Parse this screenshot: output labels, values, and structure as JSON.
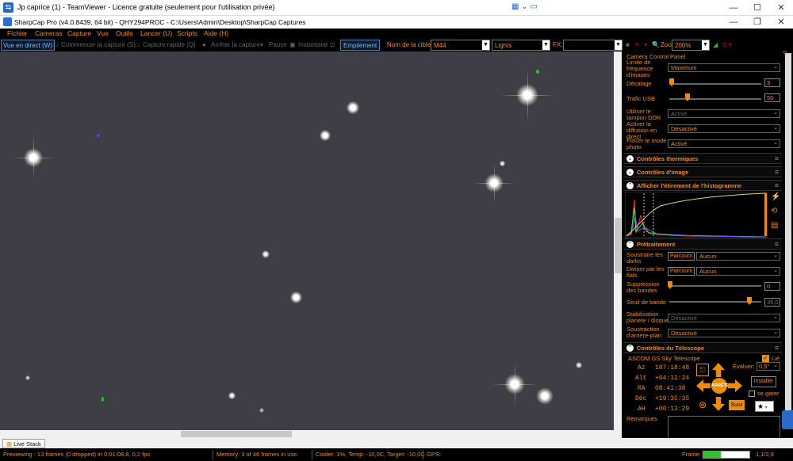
{
  "teamviewer": {
    "title": "Jp caprice (1) - TeamViewer - Licence gratuite (seulement pour l'utilisation privée)",
    "icon": "teamviewer-icon"
  },
  "sharpcap": {
    "title": "SharpCap Pro (v4.0.8439, 64 bit) - QHY294PROC - C:\\Users\\Admin\\Desktop\\SharpCap Captures"
  },
  "menu": [
    "Fichier",
    "Cameras",
    "Capture",
    "Vue",
    "Outils",
    "Lancer (U)",
    "Scripts",
    "Aide (H)"
  ],
  "toolbar": {
    "live_view": "Vue en direct (W)",
    "start_capture": "Commencer la capture (S)",
    "quick_capture": "Capture rapide (Q)",
    "stop_capture": "Arrêter la capture",
    "pause": "Pause",
    "snapshot": "Instantané",
    "stacking": "Empilement",
    "target_label": "Nom de la cible:",
    "target_value": "M44",
    "frame_type": "Lights",
    "fx_label": "FX:",
    "fx_value": "",
    "zoom_label": "Zoom:",
    "zoom_value": "200%"
  },
  "panel": {
    "title": "Camera Control Panel",
    "frame_rate_label": "Limite de fréquence d'images",
    "frame_rate_value": "Maximum",
    "offset_label": "Décalage",
    "offset_value": "3",
    "usb_label": "Trafic USB",
    "usb_value": "50",
    "ddr_label": "Utiliser le tampon DDR",
    "ddr_value": "Activé",
    "live_diffusion_label": "Activer la diffusion en direct",
    "live_diffusion_value": "Désactivé",
    "force_photo_label": "Forcer le mode photo",
    "force_photo_value": "Activé",
    "thermal": "Contrôles thermiques",
    "image_controls": "Contrôles d'image",
    "histogram": "Afficher l'étirement de l'histogramme",
    "preprocessing": "Prétraitement",
    "darks_label": "Soustraire les darks",
    "darks_value": "Aucun",
    "flats_label": "Diviser par les flats",
    "flats_value": "Aucun",
    "browse": "Parcourir...",
    "banding_label": "Suppression des bandes",
    "banding_value": "0",
    "band_threshold_label": "Seuil de bande",
    "band_threshold_value": "35,0",
    "stabilize_label": "Stabilisation planète / disque",
    "stabilize_value": "Désactivé",
    "bg_label": "Soustraction d'arrière-plan",
    "bg_value": "Désactivé",
    "telescope": "Contrôles du Télescope",
    "ascom": "ASCOM GS Sky Telescope",
    "linked": "Lié",
    "az_label": "Az",
    "az": "187:18:48",
    "alt_label": "Alt",
    "alt": "+64:11:24",
    "ra_label": "RA",
    "ra": "08:41:38",
    "dec_label": "Déc",
    "dec": "+19:35:35",
    "ah_label": "AH",
    "ah": "+00:13:29",
    "rate_label": "Évaluer:",
    "rate_value": "0,5°",
    "install": "Installer",
    "park_label": "se garer",
    "stop": "ARRÊTE",
    "follow": "Suivi",
    "remarks": "Remarques",
    "side_label": "g."
  },
  "tab": "Live Stack",
  "status": {
    "previewing": "Previewing : 13 frames (0 dropped) in 0:01:08,8, 0,2 fps",
    "memory": "Memory: 3 of 46 frames in use.",
    "cooler": "Cooler: 1%, Temp: -10,0C, Target: -10,0C",
    "gps": "GPS:",
    "frame_label": "Frame:",
    "frame_progress": 0.38,
    "frame_value": "1,1/2,9"
  },
  "colors": {
    "accent": "#f08c00",
    "sky": "#3f3d45"
  }
}
